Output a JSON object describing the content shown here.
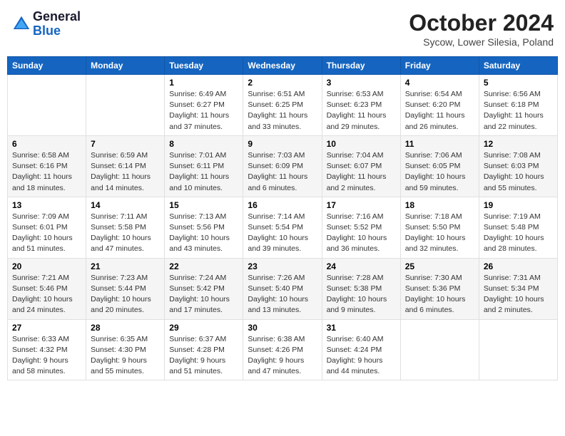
{
  "header": {
    "logo_line1": "General",
    "logo_line2": "Blue",
    "month": "October 2024",
    "location": "Sycow, Lower Silesia, Poland"
  },
  "days_of_week": [
    "Sunday",
    "Monday",
    "Tuesday",
    "Wednesday",
    "Thursday",
    "Friday",
    "Saturday"
  ],
  "weeks": [
    [
      {
        "day": "",
        "info": ""
      },
      {
        "day": "",
        "info": ""
      },
      {
        "day": "1",
        "info": "Sunrise: 6:49 AM\nSunset: 6:27 PM\nDaylight: 11 hours\nand 37 minutes."
      },
      {
        "day": "2",
        "info": "Sunrise: 6:51 AM\nSunset: 6:25 PM\nDaylight: 11 hours\nand 33 minutes."
      },
      {
        "day": "3",
        "info": "Sunrise: 6:53 AM\nSunset: 6:23 PM\nDaylight: 11 hours\nand 29 minutes."
      },
      {
        "day": "4",
        "info": "Sunrise: 6:54 AM\nSunset: 6:20 PM\nDaylight: 11 hours\nand 26 minutes."
      },
      {
        "day": "5",
        "info": "Sunrise: 6:56 AM\nSunset: 6:18 PM\nDaylight: 11 hours\nand 22 minutes."
      }
    ],
    [
      {
        "day": "6",
        "info": "Sunrise: 6:58 AM\nSunset: 6:16 PM\nDaylight: 11 hours\nand 18 minutes."
      },
      {
        "day": "7",
        "info": "Sunrise: 6:59 AM\nSunset: 6:14 PM\nDaylight: 11 hours\nand 14 minutes."
      },
      {
        "day": "8",
        "info": "Sunrise: 7:01 AM\nSunset: 6:11 PM\nDaylight: 11 hours\nand 10 minutes."
      },
      {
        "day": "9",
        "info": "Sunrise: 7:03 AM\nSunset: 6:09 PM\nDaylight: 11 hours\nand 6 minutes."
      },
      {
        "day": "10",
        "info": "Sunrise: 7:04 AM\nSunset: 6:07 PM\nDaylight: 11 hours\nand 2 minutes."
      },
      {
        "day": "11",
        "info": "Sunrise: 7:06 AM\nSunset: 6:05 PM\nDaylight: 10 hours\nand 59 minutes."
      },
      {
        "day": "12",
        "info": "Sunrise: 7:08 AM\nSunset: 6:03 PM\nDaylight: 10 hours\nand 55 minutes."
      }
    ],
    [
      {
        "day": "13",
        "info": "Sunrise: 7:09 AM\nSunset: 6:01 PM\nDaylight: 10 hours\nand 51 minutes."
      },
      {
        "day": "14",
        "info": "Sunrise: 7:11 AM\nSunset: 5:58 PM\nDaylight: 10 hours\nand 47 minutes."
      },
      {
        "day": "15",
        "info": "Sunrise: 7:13 AM\nSunset: 5:56 PM\nDaylight: 10 hours\nand 43 minutes."
      },
      {
        "day": "16",
        "info": "Sunrise: 7:14 AM\nSunset: 5:54 PM\nDaylight: 10 hours\nand 39 minutes."
      },
      {
        "day": "17",
        "info": "Sunrise: 7:16 AM\nSunset: 5:52 PM\nDaylight: 10 hours\nand 36 minutes."
      },
      {
        "day": "18",
        "info": "Sunrise: 7:18 AM\nSunset: 5:50 PM\nDaylight: 10 hours\nand 32 minutes."
      },
      {
        "day": "19",
        "info": "Sunrise: 7:19 AM\nSunset: 5:48 PM\nDaylight: 10 hours\nand 28 minutes."
      }
    ],
    [
      {
        "day": "20",
        "info": "Sunrise: 7:21 AM\nSunset: 5:46 PM\nDaylight: 10 hours\nand 24 minutes."
      },
      {
        "day": "21",
        "info": "Sunrise: 7:23 AM\nSunset: 5:44 PM\nDaylight: 10 hours\nand 20 minutes."
      },
      {
        "day": "22",
        "info": "Sunrise: 7:24 AM\nSunset: 5:42 PM\nDaylight: 10 hours\nand 17 minutes."
      },
      {
        "day": "23",
        "info": "Sunrise: 7:26 AM\nSunset: 5:40 PM\nDaylight: 10 hours\nand 13 minutes."
      },
      {
        "day": "24",
        "info": "Sunrise: 7:28 AM\nSunset: 5:38 PM\nDaylight: 10 hours\nand 9 minutes."
      },
      {
        "day": "25",
        "info": "Sunrise: 7:30 AM\nSunset: 5:36 PM\nDaylight: 10 hours\nand 6 minutes."
      },
      {
        "day": "26",
        "info": "Sunrise: 7:31 AM\nSunset: 5:34 PM\nDaylight: 10 hours\nand 2 minutes."
      }
    ],
    [
      {
        "day": "27",
        "info": "Sunrise: 6:33 AM\nSunset: 4:32 PM\nDaylight: 9 hours\nand 58 minutes."
      },
      {
        "day": "28",
        "info": "Sunrise: 6:35 AM\nSunset: 4:30 PM\nDaylight: 9 hours\nand 55 minutes."
      },
      {
        "day": "29",
        "info": "Sunrise: 6:37 AM\nSunset: 4:28 PM\nDaylight: 9 hours\nand 51 minutes."
      },
      {
        "day": "30",
        "info": "Sunrise: 6:38 AM\nSunset: 4:26 PM\nDaylight: 9 hours\nand 47 minutes."
      },
      {
        "day": "31",
        "info": "Sunrise: 6:40 AM\nSunset: 4:24 PM\nDaylight: 9 hours\nand 44 minutes."
      },
      {
        "day": "",
        "info": ""
      },
      {
        "day": "",
        "info": ""
      }
    ]
  ]
}
